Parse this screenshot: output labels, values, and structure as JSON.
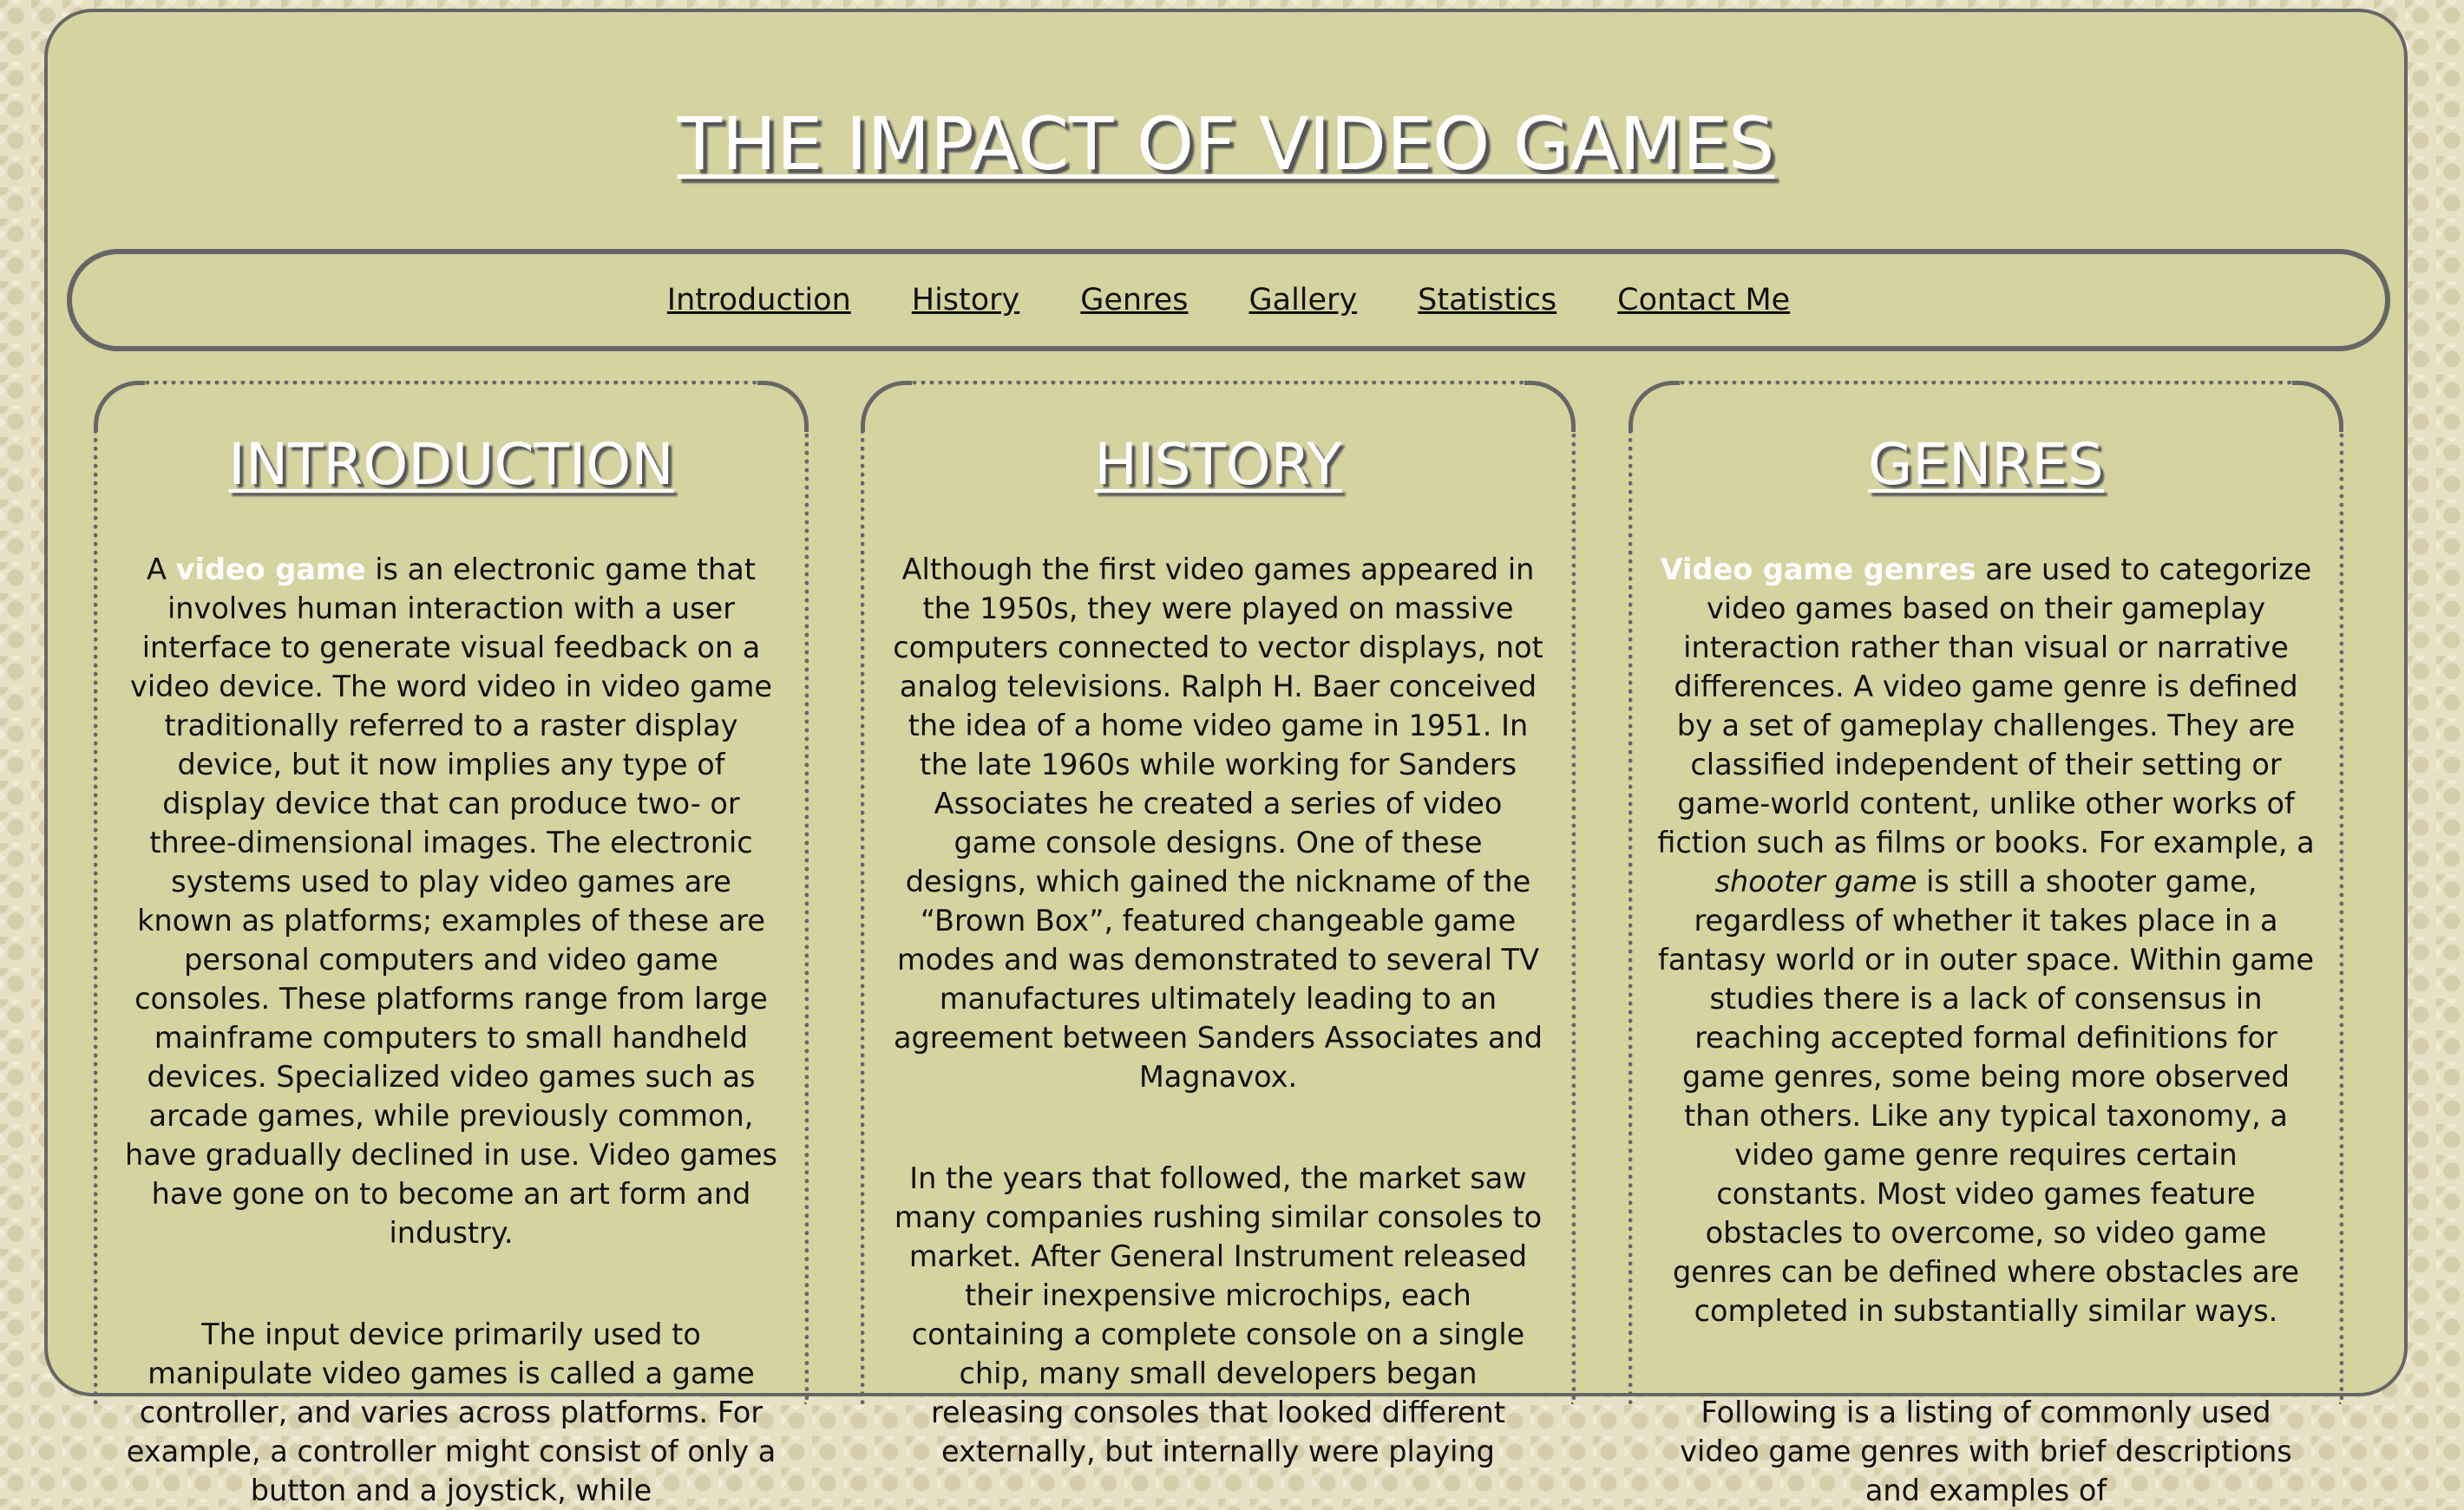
{
  "header": {
    "title": "THE IMPACT OF VIDEO GAMES"
  },
  "nav": {
    "items": [
      "Introduction",
      "History",
      "Genres",
      "Gallery",
      "Statistics",
      "Contact Me"
    ]
  },
  "intro": {
    "title": "INTRODUCTION",
    "p1_lead": "A ",
    "p1_link": "video game",
    "p1_rest": " is an electronic game that involves human interaction with a user interface to generate visual feedback on a video device. The word video in video game traditionally referred to a raster display device, but it now implies any type of display device that can produce two- or three-dimensional images. The electronic systems used to play video games are known as platforms; examples of these are personal computers and video game consoles. These platforms range from large mainframe computers to small handheld devices. Specialized video games such as arcade games, while previously common, have gradually declined in use. Video games have gone on to become an art form and industry.",
    "p2": "The input device primarily used to manipulate video games is called a game controller, and varies across platforms. For example, a controller might consist of only a button and a joystick, while"
  },
  "history": {
    "title": "HISTORY",
    "p1": "Although the first video games appeared in the 1950s, they were played on massive computers connected to vector displays, not analog televisions. Ralph H. Baer conceived the idea of a home video game in 1951. In the late 1960s while working for Sanders Associates he created a series of video game console designs. One of these designs, which gained the nickname of the “Brown Box”, featured changeable game modes and was demonstrated to several TV manufactures ultimately leading to an agreement between Sanders Associates and Magnavox.",
    "p2": "In the years that followed, the market saw many companies rushing similar consoles to market. After General Instrument released their inexpensive microchips, each containing a complete console on a single chip, many small developers began releasing consoles that looked different externally, but internally were playing"
  },
  "genres": {
    "title": "GENRES",
    "p1_link": "Video game genres",
    "p1_a": " are used to categorize video games based on their gameplay interaction rather than visual or narrative differences. A video game genre is defined by a set of gameplay challenges. They are classified independent of their setting or game-world content, unlike other works of fiction such as films or books. For example, a ",
    "p1_em": "shooter game",
    "p1_b": " is still a shooter game, regardless of whether it takes place in a fantasy world or in outer space. Within game studies there is a lack of consensus in reaching accepted formal definitions for game genres, some being more observed than others. Like any typical taxonomy, a video game genre requires certain constants. Most video games feature obstacles to overcome, so video game genres can be defined where obstacles are completed in substantially similar ways.",
    "p2": "Following is a listing of commonly used video game genres with brief descriptions and examples of"
  }
}
